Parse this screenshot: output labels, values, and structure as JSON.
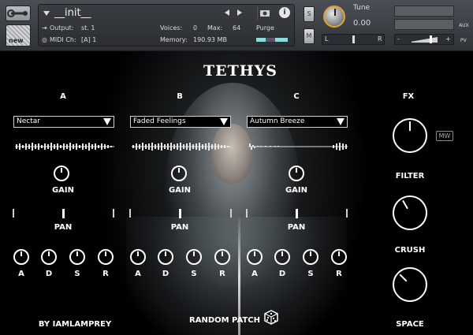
{
  "header": {
    "instrument_name": "__init__",
    "output_label": "Output:",
    "output_value": "st. 1",
    "midi_label": "MIDI Ch:",
    "midi_value": "[A]  1",
    "voices_label": "Voices:",
    "voices_value": "0",
    "max_label": "Max:",
    "max_value": "64",
    "memory_label": "Memory:",
    "memory_value": "190.93 MB",
    "purge_label": "Purge",
    "new_label": "new",
    "solo_label": "S",
    "mute_label": "M",
    "tune_label": "Tune",
    "tune_value": "0.00",
    "pan_left": "L",
    "pan_right": "R",
    "aux_label": "AUX",
    "pv_label": "PV",
    "volume_minus": "-",
    "volume_plus": "+"
  },
  "instrument": {
    "title": "TETHYS",
    "layers": [
      {
        "letter": "A",
        "preset": "Nectar",
        "gain_label": "GAIN",
        "pan_label": "PAN",
        "adsr": [
          "A",
          "D",
          "S",
          "R"
        ]
      },
      {
        "letter": "B",
        "preset": "Faded Feelings",
        "gain_label": "GAIN",
        "pan_label": "PAN",
        "adsr": [
          "A",
          "D",
          "S",
          "R"
        ]
      },
      {
        "letter": "C",
        "preset": "Autumn Breeze",
        "gain_label": "GAIN",
        "pan_label": "PAN",
        "adsr": [
          "A",
          "D",
          "S",
          "R"
        ]
      }
    ],
    "fx": {
      "title": "FX",
      "mw_label": "MW",
      "filter_label": "FILTER",
      "crush_label": "CRUSH",
      "space_label": "SPACE"
    },
    "credit": "BY IAMLAMPREY",
    "random_patch": "RANDOM PATCH"
  }
}
